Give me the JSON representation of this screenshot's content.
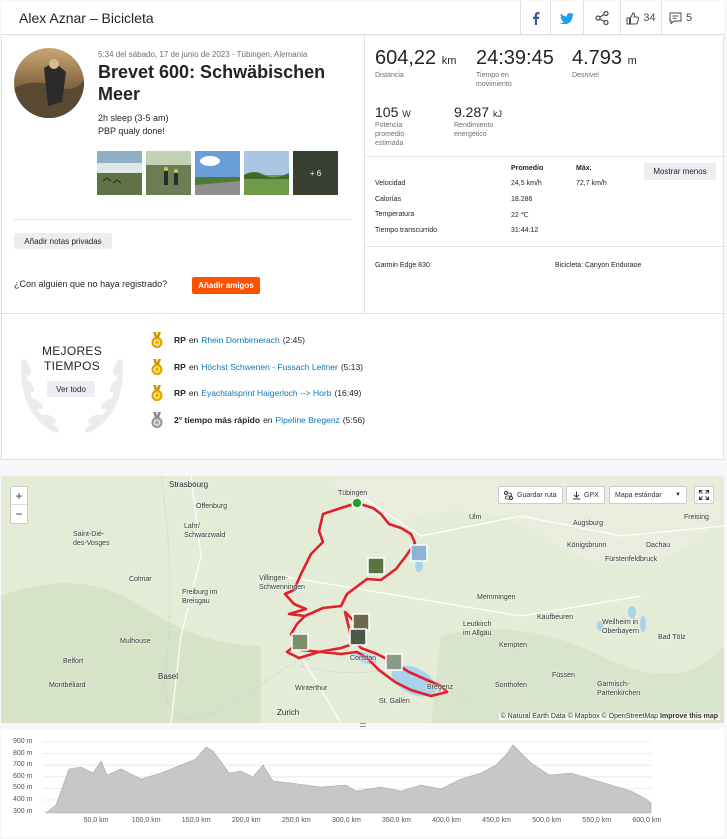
{
  "header": {
    "title": "Alex Aznar – Bicicleta",
    "kudos_count": "34",
    "comments_count": "5"
  },
  "activity": {
    "meta": "5:34 del sábado, 17 de junio de 2023 · Tübingen, Alemania",
    "title": "Brevet 600: Schwäbischen Meer",
    "description_line1": "2h sleep (3-5 am)",
    "description_line2": "PBP qualy done!",
    "photos_more": "+ 6",
    "private_notes_button": "Añadir notas privadas",
    "invite_text": "¿Con alguien que no haya registrado?",
    "add_friends_button": "Añadir amigos"
  },
  "stats": {
    "distance_value": "604,22",
    "distance_unit": "km",
    "distance_label": "Distancia",
    "moving_time_value": "24:39:45",
    "moving_time_label": "Tiempo en movimiento",
    "elevation_value": "4.793",
    "elevation_unit": "m",
    "elevation_label": "Desnivel",
    "power_value": "105",
    "power_unit": "W",
    "power_label": "Potencia promedio estimada",
    "energy_value": "9.287",
    "energy_unit": "kJ",
    "energy_label": "Rendimiento energético",
    "col_avg": "Promedio",
    "col_max": "Máx.",
    "show_less_button": "Mostrar menos",
    "rows": [
      {
        "label": "Velocidad",
        "avg": "24,5 km/h",
        "max": "72,7 km/h"
      },
      {
        "label": "Calorías",
        "avg": "18.286",
        "max": ""
      },
      {
        "label": "Temperatura",
        "avg": "22 ℃",
        "max": ""
      },
      {
        "label": "Tiempo transcurrido",
        "avg": "31:44:12",
        "max": ""
      }
    ],
    "device": "Garmin Edge 830",
    "bike": "Bicicleta: Canyon Enduraoe"
  },
  "best_efforts": {
    "title_line1": "MEJORES",
    "title_line2": "TIEMPOS",
    "see_all_button": "Ver todo",
    "items": [
      {
        "badge": "RP",
        "connector": "en",
        "segment": "Rhein Dornbirnerach",
        "time": "(2:45)",
        "medal": "gold"
      },
      {
        "badge": "RP",
        "connector": "en",
        "segment": "Höchst Schwenen - Fussach Leitner",
        "time": "(5:13)",
        "medal": "gold"
      },
      {
        "badge": "RP",
        "connector": "en",
        "segment": "Eyachtalsprint Haigerloch --> Horb",
        "time": "(16:49)",
        "medal": "gold"
      },
      {
        "badge": "2° tiempo más rápido",
        "connector": "en",
        "segment": "Pipeline Bregenz",
        "time": "(5:56)",
        "medal": "silver"
      }
    ]
  },
  "map": {
    "zoom_in": "+",
    "zoom_out": "−",
    "save_route_button": "Guardar ruta",
    "gpx_button": "GPX",
    "map_style_select": "Mapa estándar",
    "attribution": "© Natural Earth Data © Mapbox © OpenStreetMap",
    "improve_link": "Improve this map",
    "labels": {
      "strasbourg": "Strasbourg",
      "offenburg": "Offenburg",
      "tubingen": "Tübingen",
      "ulm": "Ulm",
      "augsburg": "Augsburg",
      "freising": "Freising",
      "konigsbrunn": "Königsbrunn",
      "dachau": "Dachau",
      "furstenfeldbruck": "Fürstenfeldbruck",
      "saint_die": "Saint-Dié-\ndes-Vosges",
      "lahr": "Lahr/\nSchwarzwald",
      "colmar": "Colmar",
      "freiburg": "Freiburg im\nBreisgau",
      "villingen": "Villingen-\nSchwenningen",
      "memmingen": "Memmingen",
      "kaufbeuren": "Kaufbeuren",
      "leutkirch": "Leutkirch\nim Allgäu",
      "weilheim": "Weilheim in\nOberbayern",
      "mulhouse": "Mulhouse",
      "belfort": "Belfort",
      "basel": "Basel",
      "montbeliard": "Montbéliard",
      "constanz": "Constan",
      "kempten": "Kempten",
      "bad_tolz": "Bad Tölz",
      "fussen": "Füssen",
      "garmisch": "Garmisch-\nPartenkirchen",
      "winterthur": "Winterthur",
      "bregenz": "Bregenz",
      "sonthofen": "Sonthofen",
      "st_gallen": "St. Gallen",
      "zurich": "Zurich"
    }
  },
  "elevation": {
    "y_ticks": [
      "900 m",
      "800 m",
      "700 m",
      "600 m",
      "500 m",
      "400 m",
      "300 m"
    ],
    "x_ticks": [
      "50,0 km",
      "100,0 km",
      "150,0 km",
      "200,0 km",
      "250,0 km",
      "300,0 km",
      "350,0 km",
      "400,0 km",
      "450,0 km",
      "500,0 km",
      "550,0 km",
      "600,0 km"
    ]
  },
  "colors": {
    "accent": "#fc5200",
    "link": "#0a78b4",
    "route": "#e0202a",
    "text": "#242428"
  }
}
